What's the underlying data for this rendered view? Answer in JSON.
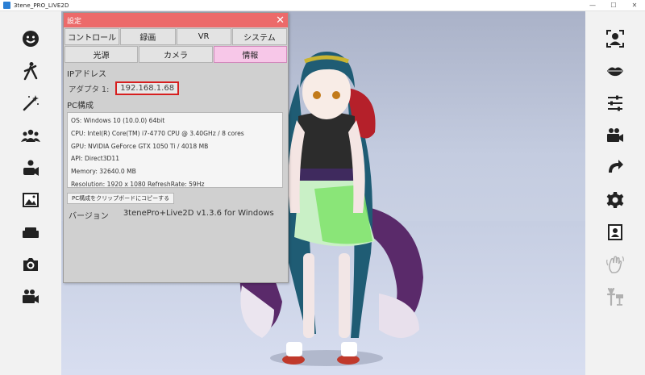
{
  "window": {
    "title": "3tene_PRO_LIVE2D",
    "minimize": "—",
    "maximize": "☐",
    "close": "✕"
  },
  "panel": {
    "title": "設定",
    "close": "✕",
    "tabs_row1": [
      "コントロール",
      "録画",
      "VR",
      "システム"
    ],
    "tabs_row2": [
      "光源",
      "カメラ",
      "情報"
    ],
    "active_tab": "情報",
    "ip_section": "IPアドレス",
    "adapter_label": "アダプタ 1:",
    "adapter_ip": "192.168.1.68",
    "pc_section": "PC構成",
    "pc_info": [
      "OS: Windows 10  (10.0.0) 64bit",
      "CPU: Intel(R) Core(TM) i7-4770 CPU @ 3.40GHz / 8 cores",
      "GPU: NVIDIA GeForce GTX 1050 Ti / 4018 MB",
      "API: Direct3D11",
      "Memory: 32640.0 MB",
      "Resolution: 1920 x 1080 RefreshRate: 59Hz"
    ],
    "copy_button": "PC構成をクリップボードにコピーする",
    "version_label": "バージョン",
    "version_value": "3tenePro+Live2D v1.3.6 for Windows"
  },
  "left_toolbar": [
    "face-icon",
    "dance-pose-icon",
    "magic-wand-icon",
    "people-icon",
    "camera-user-icon",
    "image-icon",
    "sofa-icon",
    "camera-icon",
    "video-camera-icon"
  ],
  "right_toolbar": [
    "face-tracking-icon",
    "lips-icon",
    "sliders-icon",
    "video-camera-icon",
    "redo-arrow-icon",
    "gear-icon",
    "portrait-icon",
    "hand-wave-icon",
    "presenter-icon"
  ],
  "colors": {
    "header": "#ec6a6a",
    "active_tab": "#f7c7e8",
    "highlight_box": "#d61f1f",
    "toolbar_icon": "#222222",
    "disabled_icon": "#b0b0b0"
  }
}
